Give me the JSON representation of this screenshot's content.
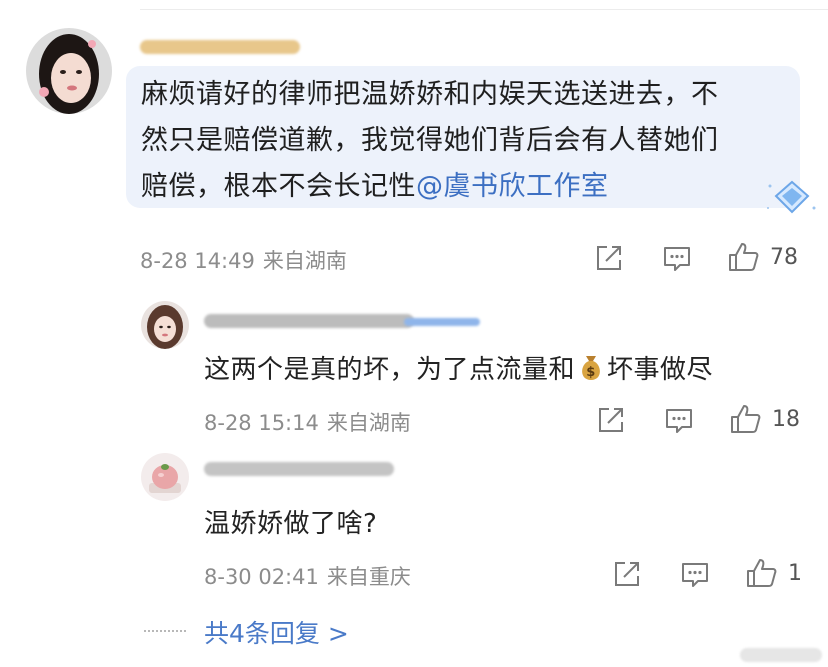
{
  "comment": {
    "text_line1": "麻烦请好的律师把温娇娇和内娱天选送进去，不",
    "text_line2": "然只是赔偿道歉，我觉得她们背后会有人替她们",
    "text_line3": "赔偿，根本不会长记性",
    "mention": "@虞书欣工作室",
    "time": "8-28 14:49",
    "location": "来自湖南",
    "likes": "78"
  },
  "replies": [
    {
      "text_before": "这两个是真的坏，为了点流量和",
      "text_after": "坏事做尽",
      "time": "8-28 15:14",
      "location": "来自湖南",
      "likes": "18"
    },
    {
      "text": "温娇娇做了啥?",
      "time": "8-30 02:41",
      "location": "来自重庆",
      "likes": "1"
    }
  ],
  "more_replies_label": "共4条回复 >",
  "icons": [
    "share-icon",
    "comment-icon",
    "like-icon",
    "money-bag-icon",
    "gem-badge-icon"
  ],
  "colors": {
    "mention": "#3c6fc2",
    "bubble": "#edf2fb",
    "meta": "#8c8c8c"
  }
}
